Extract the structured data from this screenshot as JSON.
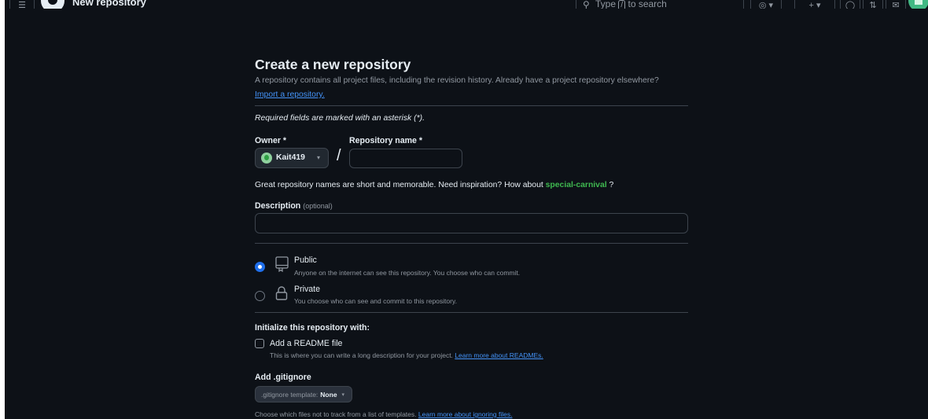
{
  "header": {
    "context_title": "New repository",
    "search": {
      "prefix": "Type",
      "key": "/",
      "suffix": "to search"
    }
  },
  "page": {
    "title": "Create a new repository",
    "subtitle": "A repository contains all project files, including the revision history. Already have a project repository elsewhere?",
    "import_link": "Import a repository.",
    "required_note": "Required fields are marked with an asterisk (*)."
  },
  "owner": {
    "label": "Owner *",
    "value": "Kait419"
  },
  "repo_name": {
    "label": "Repository name *",
    "value": ""
  },
  "separator": "/",
  "name_hint": {
    "text": "Great repository names are short and memorable. Need inspiration? How about",
    "suggestion": "special-carnival",
    "end": "?"
  },
  "description": {
    "label": "Description",
    "optional": "(optional)",
    "value": ""
  },
  "visibility": {
    "selected": "public",
    "options": [
      {
        "id": "public",
        "label": "Public",
        "description": "Anyone on the internet can see this repository. You choose who can commit.",
        "icon": "repo-icon"
      },
      {
        "id": "private",
        "label": "Private",
        "description": "You choose who can see and commit to this repository.",
        "icon": "lock-icon"
      }
    ]
  },
  "initialize": {
    "heading": "Initialize this repository with:",
    "readme": {
      "label": "Add a README file",
      "checked": false,
      "description": "This is where you can write a long description for your project.",
      "link": "Learn more about READMEs."
    }
  },
  "gitignore": {
    "heading": "Add .gitignore",
    "button_prefix": ".gitignore template:",
    "button_value": "None",
    "description": "Choose which files not to track from a list of templates.",
    "link": "Learn more about ignoring files."
  },
  "colors": {
    "background": "#0d1117",
    "border": "#3d444d",
    "text": "#e6edf3",
    "muted": "#9198a1",
    "link": "#4493f8",
    "accent_green": "#3fb950",
    "radio_selected": "#1f6feb"
  }
}
